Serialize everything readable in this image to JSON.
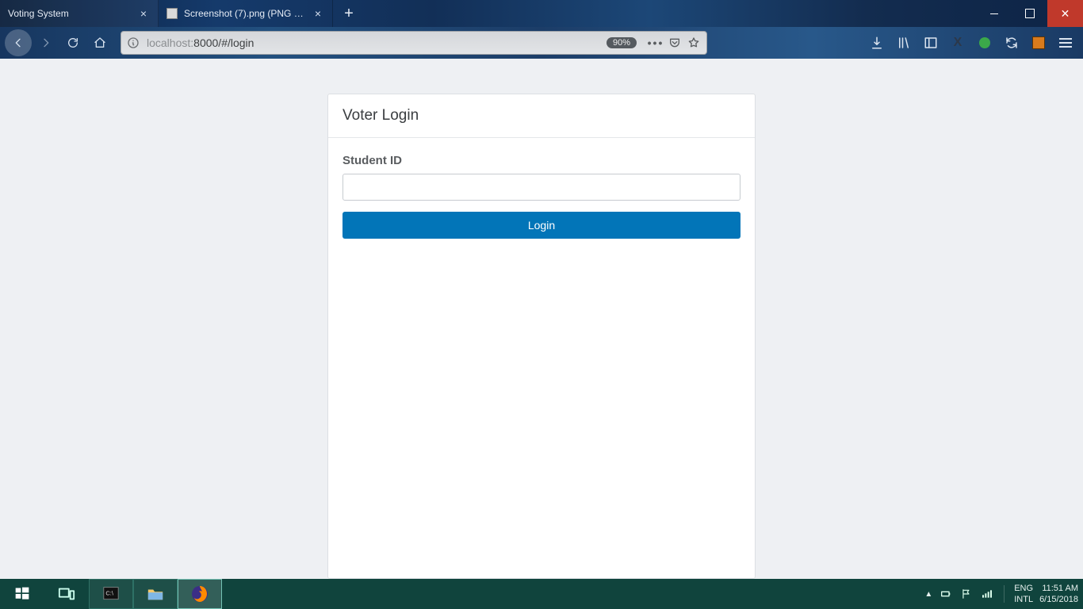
{
  "tabs": [
    {
      "label": "Voting System"
    },
    {
      "label": "Screenshot (7).png (PNG Imag"
    }
  ],
  "url": {
    "host_prefix": "localhost:",
    "host_suffix": "8000/#/login",
    "zoom": "90%"
  },
  "login": {
    "title": "Voter Login",
    "field_label": "Student ID",
    "value": "",
    "button": "Login"
  },
  "tray": {
    "lang1": "ENG",
    "lang2": "INTL",
    "time": "11:51 AM",
    "date": "6/15/2018"
  }
}
